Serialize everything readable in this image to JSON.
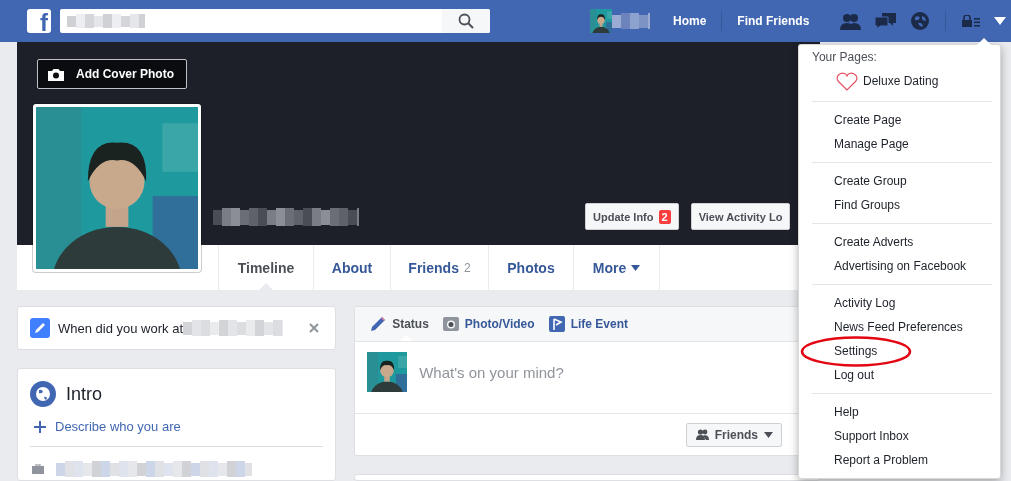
{
  "top_bar": {
    "logo": "f",
    "nav_links": [
      "Home",
      "Find Friends"
    ]
  },
  "cover": {
    "add_cover_button": "Add Cover Photo",
    "actions": [
      {
        "label": "Update Info",
        "badge": "2"
      },
      {
        "label": "View Activity Lo"
      }
    ]
  },
  "tabs": [
    {
      "label": "Timeline",
      "kind": "link",
      "selected": true
    },
    {
      "label": "About",
      "kind": "link",
      "selected": false
    },
    {
      "label": "Friends",
      "count": "2",
      "kind": "link",
      "selected": false
    },
    {
      "label": "Photos",
      "kind": "link",
      "selected": false
    },
    {
      "label": "More",
      "kind": "dropdown",
      "selected": false
    }
  ],
  "prompt_card": {
    "text": "When did you work at"
  },
  "intro": {
    "title": "Intro",
    "link": "Describe who you are"
  },
  "composer": {
    "tabs": [
      {
        "label": "Status",
        "kind": "status",
        "selected": true
      },
      {
        "label": "Photo/Video",
        "selected": false
      },
      {
        "label": "Life Event",
        "kind": "event",
        "selected": false
      }
    ],
    "placeholder": "What's on your mind?",
    "audience": "Friends"
  },
  "menu": {
    "heading": "Your Pages:",
    "pages": [
      {
        "name": "Deluxe Dating"
      }
    ],
    "groups": [
      {
        "items": [
          {
            "label": "Create Page",
            "circled": false
          },
          {
            "label": "Manage Page",
            "circled": false
          }
        ]
      },
      {
        "items": [
          {
            "label": "Create Group",
            "circled": false
          },
          {
            "label": "Find Groups",
            "circled": false
          }
        ]
      },
      {
        "items": [
          {
            "label": "Create Adverts",
            "circled": false
          },
          {
            "label": "Advertising on Facebook",
            "circled": false
          }
        ]
      },
      {
        "items": [
          {
            "label": "Activity Log",
            "circled": false
          },
          {
            "label": "News Feed Preferences",
            "circled": false
          },
          {
            "label": "Settings",
            "circled": true
          },
          {
            "label": "Log out",
            "circled": false
          }
        ]
      },
      {
        "items": [
          {
            "label": "Help",
            "circled": false
          },
          {
            "label": "Support Inbox",
            "circled": false
          },
          {
            "label": "Report a Problem",
            "circled": false
          }
        ]
      }
    ]
  }
}
